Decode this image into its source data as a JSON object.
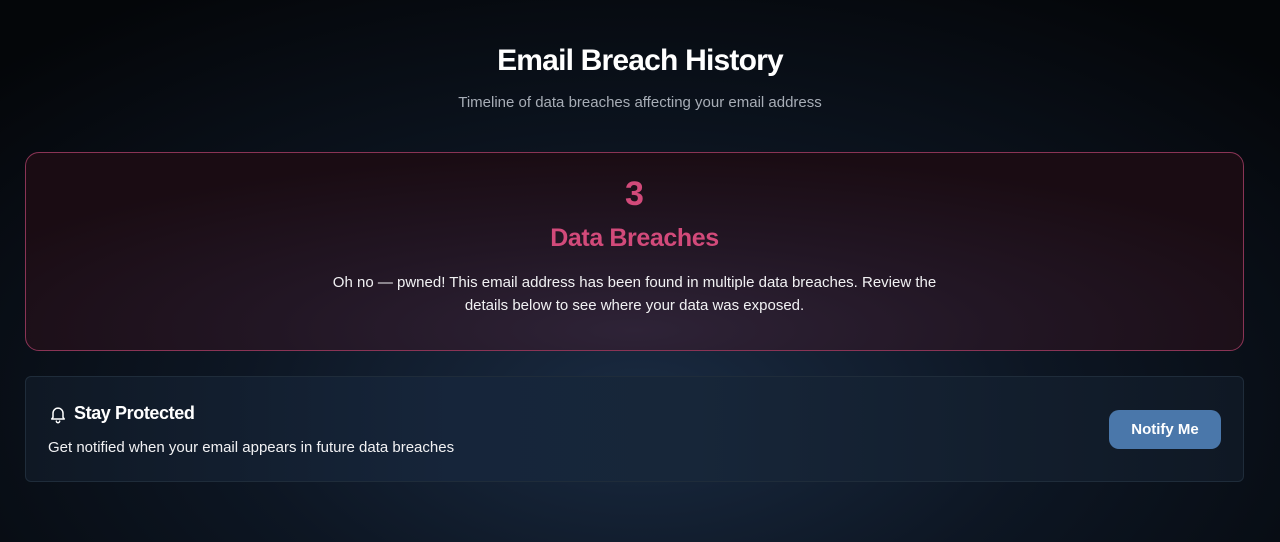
{
  "header": {
    "title": "Email Breach History",
    "subtitle": "Timeline of data breaches affecting your email address"
  },
  "summary": {
    "count": "3",
    "label": "Data Breaches",
    "message": "Oh no — pwned! This email address has been found in multiple data breaches. Review the details below to see where your data was exposed."
  },
  "protection": {
    "icon": "bell-icon",
    "title": "Stay Protected",
    "description": "Get notified when your email appears in future data breaches",
    "button_label": "Notify Me"
  },
  "colors": {
    "accent_pink": "#d24a7a",
    "card_border_pink": "#8a3455",
    "button_blue": "#4a77aa",
    "subtitle_gray": "#a7adb6"
  }
}
